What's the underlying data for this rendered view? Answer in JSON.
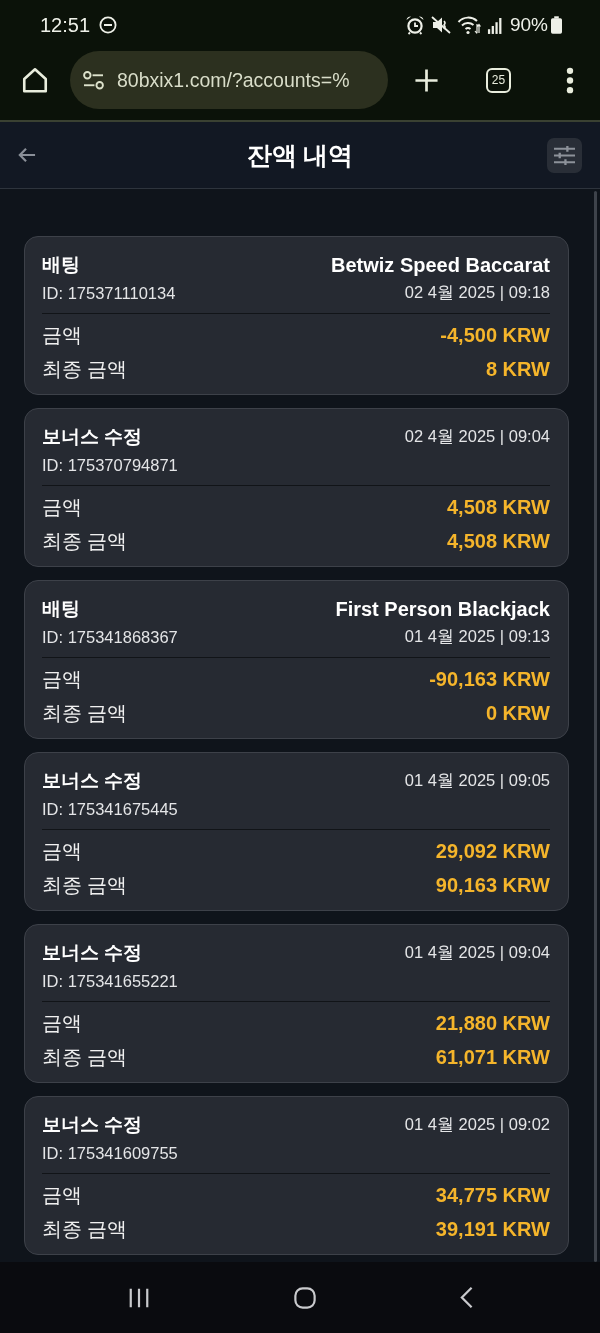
{
  "status_bar": {
    "time": "12:51",
    "battery": "90%"
  },
  "browser": {
    "url": "80bxix1.com/?accounts=%",
    "tab_count": "25"
  },
  "header": {
    "title": "잔액 내역"
  },
  "transactions": [
    {
      "type": "배팅",
      "game": "Betwiz Speed Baccarat",
      "id": "ID: 175371110134",
      "date": "02 4월 2025 | 09:18",
      "amount_label": "금액",
      "amount": "-4,500 KRW",
      "final_label": "최종 금액",
      "final_amount": "8 KRW"
    },
    {
      "type": "보너스 수정",
      "id": "ID: 175370794871",
      "date": "02 4월 2025 | 09:04",
      "amount_label": "금액",
      "amount": "4,508 KRW",
      "final_label": "최종 금액",
      "final_amount": "4,508 KRW"
    },
    {
      "type": "배팅",
      "game": "First Person Blackjack",
      "id": "ID: 175341868367",
      "date": "01 4월 2025 | 09:13",
      "amount_label": "금액",
      "amount": "-90,163 KRW",
      "final_label": "최종 금액",
      "final_amount": "0 KRW"
    },
    {
      "type": "보너스 수정",
      "id": "ID: 175341675445",
      "date": "01 4월 2025 | 09:05",
      "amount_label": "금액",
      "amount": "29,092 KRW",
      "final_label": "최종 금액",
      "final_amount": "90,163 KRW"
    },
    {
      "type": "보너스 수정",
      "id": "ID: 175341655221",
      "date": "01 4월 2025 | 09:04",
      "amount_label": "금액",
      "amount": "21,880 KRW",
      "final_label": "최종 금액",
      "final_amount": "61,071 KRW"
    },
    {
      "type": "보너스 수정",
      "id": "ID: 175341609755",
      "date": "01 4월 2025 | 09:02",
      "amount_label": "금액",
      "amount": "34,775 KRW",
      "final_label": "최종 금액",
      "final_amount": "39,191 KRW"
    }
  ]
}
